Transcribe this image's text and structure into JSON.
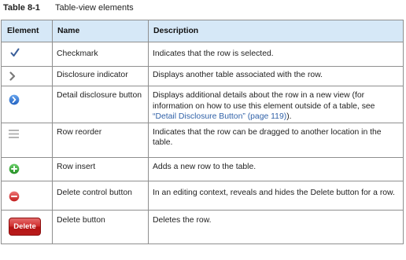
{
  "caption": {
    "number": "Table 8-1",
    "title": "Table-view elements"
  },
  "table": {
    "headers": [
      "Element",
      "Name",
      "Description"
    ],
    "rows": [
      {
        "icon": "checkmark-icon",
        "name": "Checkmark",
        "description": "Indicates that the row is selected."
      },
      {
        "icon": "disclosure-chevron-icon",
        "name": "Disclosure indicator",
        "description": "Displays another table associated with the row."
      },
      {
        "icon": "detail-disclosure-icon",
        "name": "Detail disclosure button",
        "description_before": "Displays additional details about the row in a new view (for information on how to use this element outside of a table, see ",
        "description_link": "“Detail Disclosure Button” (page 119)",
        "description_after": ")."
      },
      {
        "icon": "reorder-handle-icon",
        "name": "Row reorder",
        "description": "Indicates that the row can be dragged to another location in the table."
      },
      {
        "icon": "insert-plus-icon",
        "name": "Row insert",
        "description": "Adds a new row to the table."
      },
      {
        "icon": "delete-minus-icon",
        "name": "Delete control button",
        "description": "In an editing context, reveals and hides the Delete button for a row."
      },
      {
        "icon": "delete-button-icon",
        "icon_label": "Delete",
        "name": "Delete button",
        "description": "Deletes the row."
      }
    ]
  },
  "colors": {
    "header_bg": "#d6e8f7",
    "link": "#3162a8",
    "delete_red": "#c62222",
    "insert_green": "#2e9b2e",
    "detail_blue": "#2a71d0"
  }
}
